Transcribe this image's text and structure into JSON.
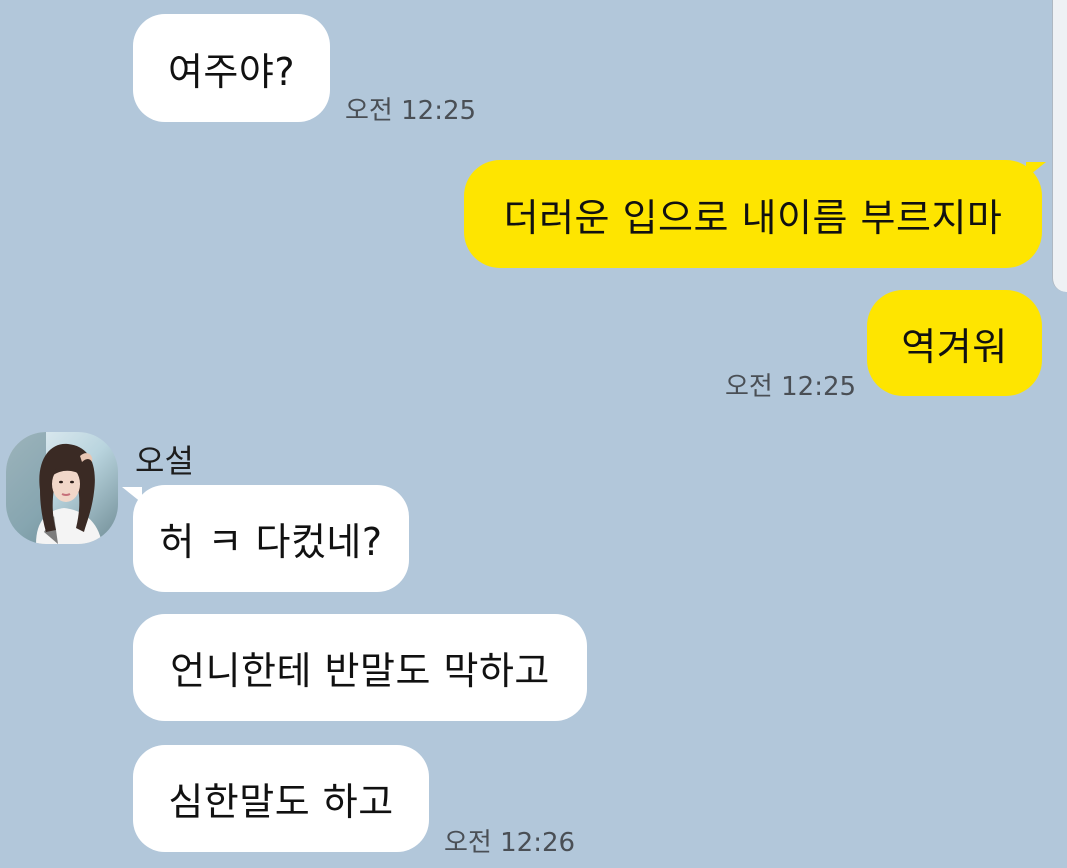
{
  "colors": {
    "background": "#b2c7da",
    "incoming_bubble": "#ffffff",
    "outgoing_bubble": "#fee500",
    "timestamp": "#4a4f55"
  },
  "messages": {
    "m1": {
      "text": "여주야?",
      "time": "오전 12:25"
    },
    "m2": {
      "text": "더러운 입으로 내이름 부르지마"
    },
    "m3": {
      "text": "역겨워",
      "time": "오전 12:25"
    },
    "sender": {
      "name": "오설",
      "avatar_icon": "profile-photo-icon"
    },
    "m4": {
      "text": "허 ㅋ 다컸네?"
    },
    "m5": {
      "text": "언니한테 반말도 막하고"
    },
    "m6": {
      "text": "심한말도 하고",
      "time": "오전 12:26"
    }
  }
}
